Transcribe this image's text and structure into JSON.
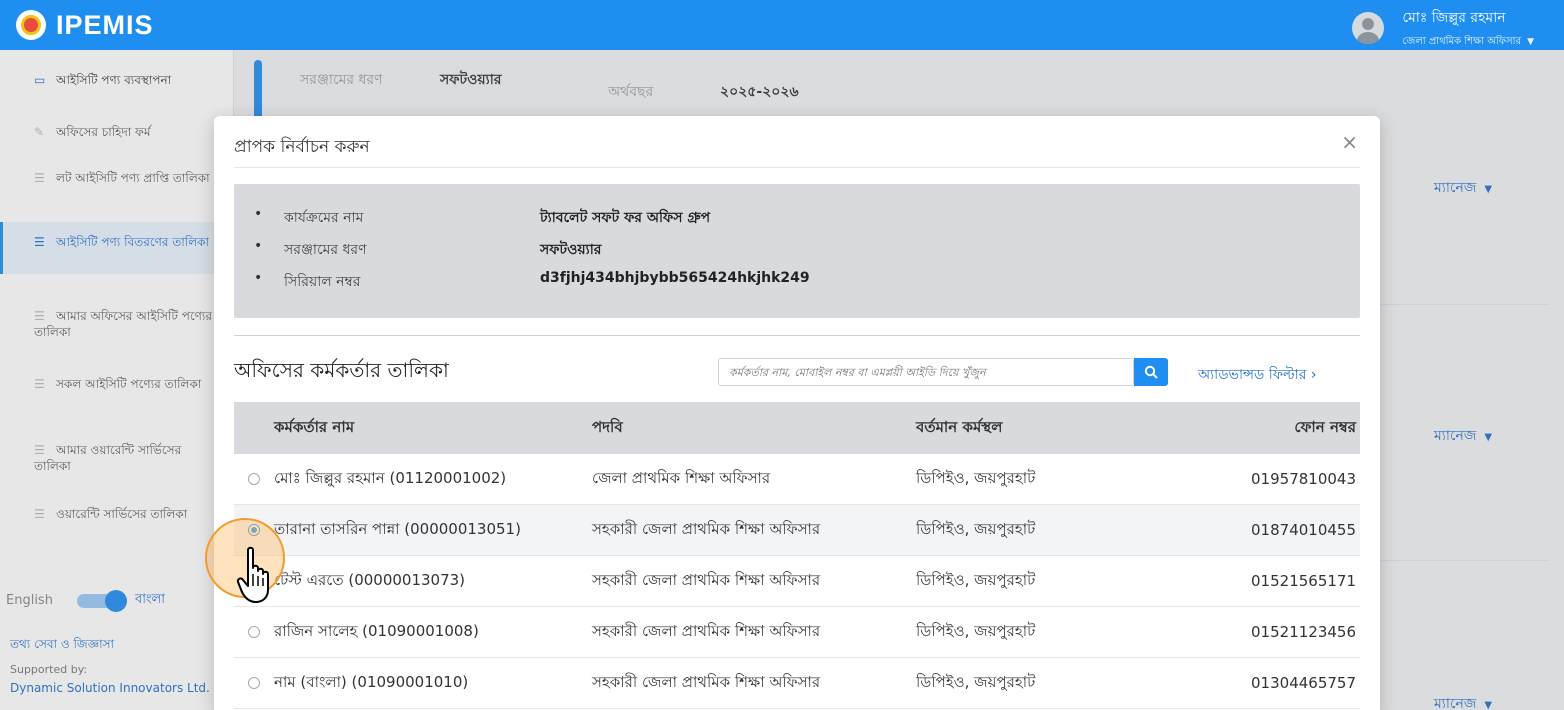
{
  "header": {
    "app_name": "IPEMIS",
    "user_name": "মোঃ জিল্লুর রহমান",
    "user_role": "জেলা প্রাথমিক শিক্ষা অফিসার",
    "caret": "▼"
  },
  "sidebar": {
    "items": [
      {
        "label": "আইসিটি পণ্য ব্যবস্থাপনা",
        "icon": "laptop-icon"
      },
      {
        "label": "অফিসের চাহিদা ফর্ম",
        "icon": "pencil-icon"
      },
      {
        "label": "লট আইসিটি পণ্য প্রাপ্তি তালিকা",
        "icon": "list-icon"
      },
      {
        "label": "আইসিটি পণ্য বিতরণের তালিকা",
        "icon": "list-icon"
      },
      {
        "label": "আমার অফিসের আইসিটি পণ্যের তালিকা",
        "icon": "list-icon"
      },
      {
        "label": "সকল আইসিটি পণ্যের তালিকা",
        "icon": "list-icon"
      },
      {
        "label": "আমার ওয়ারেন্টি সার্ভিসের তালিকা",
        "icon": "list-icon"
      },
      {
        "label": "ওয়ারেন্টি সার্ভিসের তালিকা",
        "icon": "list-icon"
      }
    ],
    "lang_en": "English",
    "lang_bn": "বাংলা",
    "info_link": "তথ্য সেবা ও জিজ্ঞাসা",
    "supported_by": "Supported by:",
    "supporter": "Dynamic Solution Innovators Ltd."
  },
  "background": {
    "equipment_type_label": "সরঞ্জামের ধরণ",
    "equipment_type_value": "সফটওয়্যার",
    "fiscal_year_label": "অর্থবছর",
    "fiscal_year_value": "২০২৫-২০২৬",
    "manage_label": "ম্যানেজ"
  },
  "modal": {
    "title": "প্রাপক নির্বাচন করুন",
    "close": "×",
    "info": [
      {
        "key": "কার্যক্রমের নাম",
        "value": "ট্যাবলেট সফট ফর অফিস গ্রুপ"
      },
      {
        "key": "সরঞ্জামের ধরণ",
        "value": "সফটওয়্যার"
      },
      {
        "key": "সিরিয়াল নম্বর",
        "value": "d3fjhj434bhjbybb565424hkjhk249"
      }
    ],
    "list_title": "অফিসের কর্মকর্তার তালিকা",
    "search_placeholder": "কর্মকর্তার নাম, মোবাইল নম্বর বা এমপ্লয়ী আইডি দিয়ে খুঁজুন",
    "advanced_filter": "অ্যাডভান্সড ফিল্টার ›",
    "columns": [
      "কর্মকর্তার নাম",
      "পদবি",
      "বর্তমান কর্মস্থল",
      "ফোন নম্বর"
    ],
    "rows": [
      {
        "name": "মোঃ জিল্লুর রহমান (01120001002)",
        "designation": "জেলা প্রাথমিক শিক্ষা অফিসার",
        "location": "ডিপিইও, জয়পুরহাট",
        "phone": "01957810043",
        "selected": false
      },
      {
        "name": "তারানা তাসরিন পান্না (00000013051)",
        "designation": "সহকারী জেলা প্রাথমিক শিক্ষা অফিসার",
        "location": "ডিপিইও, জয়পুরহাট",
        "phone": "01874010455",
        "selected": true
      },
      {
        "name": "টেস্ট এরতে (00000013073)",
        "designation": "সহকারী জেলা প্রাথমিক শিক্ষা অফিসার",
        "location": "ডিপিইও, জয়পুরহাট",
        "phone": "01521565171",
        "selected": false
      },
      {
        "name": "রাজিন সালেহ (01090001008)",
        "designation": "সহকারী জেলা প্রাথমিক শিক্ষা অফিসার",
        "location": "ডিপিইও, জয়পুরহাট",
        "phone": "01521123456",
        "selected": false
      },
      {
        "name": "নাম (বাংলা) (01090001010)",
        "designation": "সহকারী জেলা প্রাথমিক শিক্ষা অফিসার",
        "location": "ডিপিইও, জয়পুরহাট",
        "phone": "01304465757",
        "selected": false
      }
    ]
  }
}
